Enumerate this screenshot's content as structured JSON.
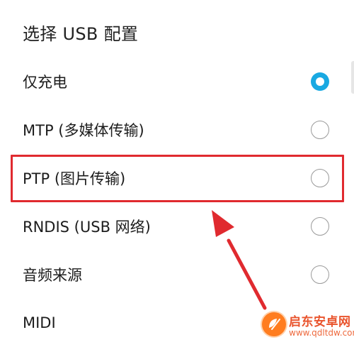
{
  "dialog": {
    "title": "选择 USB 配置"
  },
  "options": [
    {
      "label": "仅充电",
      "selected": true
    },
    {
      "label": "MTP (多媒体传输)",
      "selected": false
    },
    {
      "label": "PTP (图片传输)",
      "selected": false
    },
    {
      "label": "RNDIS (USB 网络)",
      "selected": false
    },
    {
      "label": "音频来源",
      "selected": false
    },
    {
      "label": "MIDI",
      "selected": false
    }
  ],
  "watermark": {
    "name": "启东安卓网",
    "url": "www.qdltdw.com"
  },
  "colors": {
    "selected_radio": "#19a9e2",
    "annotation": "#e02a2f",
    "watermark": "#e9542d"
  }
}
